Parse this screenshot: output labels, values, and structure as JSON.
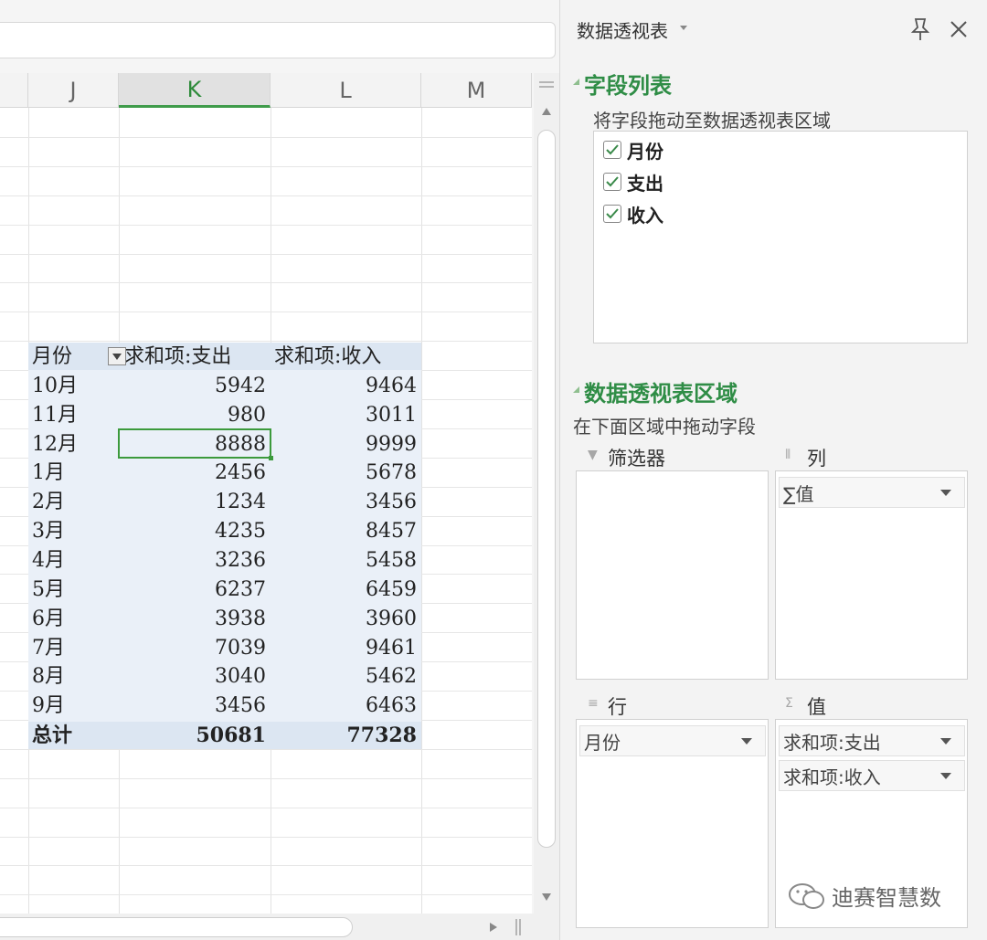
{
  "sheet": {
    "columns": [
      "J",
      "K",
      "L",
      "M"
    ],
    "pivot": {
      "headers": [
        "月份",
        "求和项:支出",
        "求和项:收入"
      ],
      "rows": [
        [
          "10月",
          "5942",
          "9464"
        ],
        [
          "11月",
          "980",
          "3011"
        ],
        [
          "12月",
          "8888",
          "9999"
        ],
        [
          "1月",
          "2456",
          "5678"
        ],
        [
          "2月",
          "1234",
          "3456"
        ],
        [
          "3月",
          "4235",
          "8457"
        ],
        [
          "4月",
          "3236",
          "5458"
        ],
        [
          "5月",
          "6237",
          "6459"
        ],
        [
          "6月",
          "3938",
          "3960"
        ],
        [
          "7月",
          "7039",
          "9461"
        ],
        [
          "8月",
          "3040",
          "5462"
        ],
        [
          "9月",
          "3456",
          "6463"
        ]
      ],
      "total": [
        "总计",
        "50681",
        "77328"
      ]
    },
    "selected_cell": "K"
  },
  "pane": {
    "title": "数据透视表",
    "field_list_title": "字段列表",
    "field_list_hint": "将字段拖动至数据透视表区域",
    "fields": [
      {
        "label": "月份",
        "checked": true
      },
      {
        "label": "支出",
        "checked": true
      },
      {
        "label": "收入",
        "checked": true
      }
    ],
    "areas_title": "数据透视表区域",
    "areas_hint": "在下面区域中拖动字段",
    "filters_label": "筛选器",
    "columns_label": "列",
    "columns_items": [
      "∑值"
    ],
    "rows_label": "行",
    "rows_items": [
      "月份"
    ],
    "values_label": "值",
    "values_items": [
      "求和项:支出",
      "求和项:收入"
    ]
  },
  "watermark": "迪赛智慧数",
  "colors": {
    "accent_green": "#2f8d46",
    "pivot_header": "#dce6f2",
    "pivot_body": "#eaf0f8"
  }
}
